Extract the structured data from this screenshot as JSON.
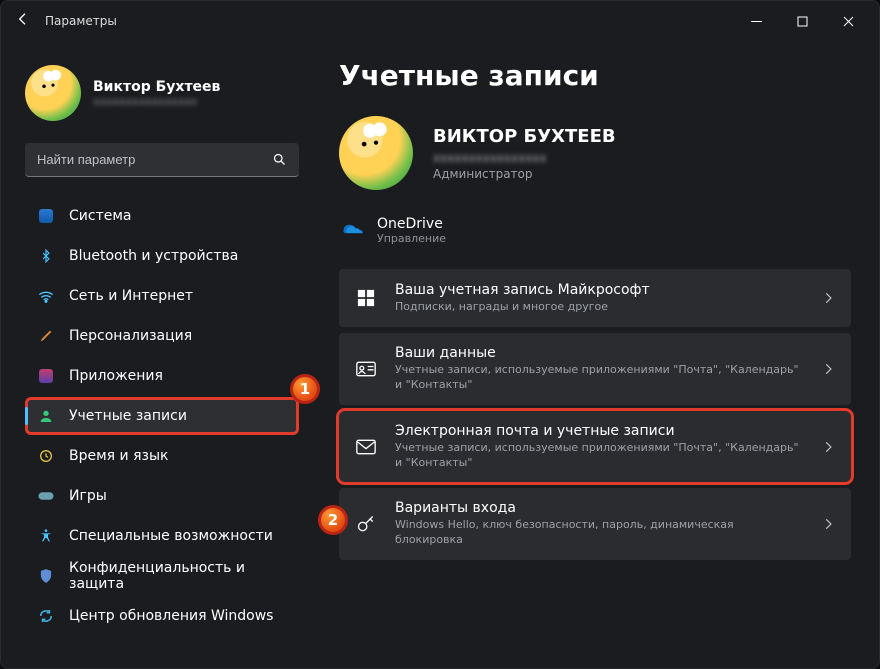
{
  "window": {
    "title": "Параметры"
  },
  "profile": {
    "name": "Виктор Бухтеев",
    "email_masked": "xxxxxxxxxxxxxxxx"
  },
  "search": {
    "placeholder": "Найти параметр"
  },
  "nav": [
    {
      "label": "Система",
      "icon": "display"
    },
    {
      "label": "Bluetooth и устройства",
      "icon": "bluetooth"
    },
    {
      "label": "Сеть и Интернет",
      "icon": "wifi"
    },
    {
      "label": "Персонализация",
      "icon": "brush"
    },
    {
      "label": "Приложения",
      "icon": "apps"
    },
    {
      "label": "Учетные записи",
      "icon": "person",
      "active": true,
      "highlight": true
    },
    {
      "label": "Время и язык",
      "icon": "clock"
    },
    {
      "label": "Игры",
      "icon": "gamepad"
    },
    {
      "label": "Специальные возможности",
      "icon": "accessibility"
    },
    {
      "label": "Конфиденциальность и защита",
      "icon": "shield"
    },
    {
      "label": "Центр обновления Windows",
      "icon": "update"
    }
  ],
  "page": {
    "title": "Учетные записи",
    "hero": {
      "name": "ВИКТОР БУХТЕЕВ",
      "email_masked": "xxxxxxxxxxxxxxxx",
      "role": "Администратор"
    },
    "onedrive": {
      "label": "OneDrive",
      "sub": "Управление"
    },
    "cards": [
      {
        "title": "Ваша учетная запись Майкрософт",
        "sub": "Подписки, награды и многое другое",
        "icon": "grid"
      },
      {
        "title": "Ваши данные",
        "sub": "Учетные записи, используемые приложениями \"Почта\", \"Календарь\" и \"Контакты\"",
        "icon": "id"
      },
      {
        "title": "Электронная почта и учетные записи",
        "sub": "Учетные записи, используемые приложениями \"Почта\", \"Календарь\" и \"Контакты\"",
        "icon": "mail",
        "highlight": true
      },
      {
        "title": "Варианты входа",
        "sub": "Windows Hello, ключ безопасности, пароль, динамическая блокировка",
        "icon": "key"
      }
    ]
  },
  "steps": {
    "1": "1",
    "2": "2"
  }
}
